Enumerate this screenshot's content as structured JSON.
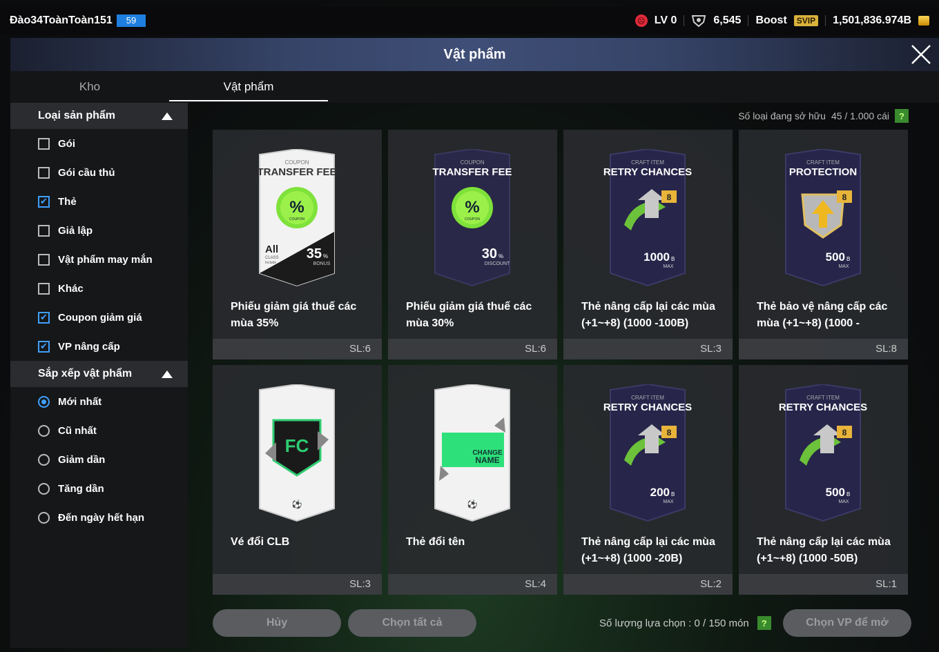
{
  "topbar": {
    "username": "Đào34ToànToàn151",
    "level_badge": "59",
    "lv": "LV 0",
    "points": "6,545",
    "boost": "Boost",
    "svip": "SVIP",
    "balance": "1,501,836.974B"
  },
  "title": "Vật phẩm",
  "tabs": [
    "Kho",
    "Vật phẩm"
  ],
  "sidebar": {
    "filter_header": "Loại sản phẩm",
    "filters": [
      {
        "label": "Gói",
        "checked": false
      },
      {
        "label": "Gói cầu thủ",
        "checked": false
      },
      {
        "label": "Thẻ",
        "checked": true
      },
      {
        "label": "Giả lập",
        "checked": false
      },
      {
        "label": "Vật phẩm may mắn",
        "checked": false
      },
      {
        "label": "Khác",
        "checked": false
      },
      {
        "label": "Coupon giảm giá",
        "checked": true
      },
      {
        "label": "VP nâng cấp",
        "checked": true
      }
    ],
    "sort_header": "Sắp xếp vật phẩm",
    "sorts": [
      {
        "label": "Mới nhất",
        "selected": true
      },
      {
        "label": "Cũ nhất",
        "selected": false
      },
      {
        "label": "Giảm dần",
        "selected": false
      },
      {
        "label": "Tăng dần",
        "selected": false
      },
      {
        "label": "Đến ngày hết hạn",
        "selected": false
      }
    ]
  },
  "owned": {
    "label": "Số loại đang sở hữu",
    "value": "45 / 1.000 cái",
    "help": "?"
  },
  "items": [
    {
      "name": "Phiếu giảm giá thuế các mùa 35%",
      "qty": "SL:6",
      "type": "coupon-white",
      "kind": "COUPON",
      "heading": "TRANSFER FEE",
      "value": "35",
      "unit": "%",
      "sub": "BONUS",
      "extra": "All",
      "extra_sub": "CLASS",
      "extra_sub2": "Include",
      "badge": "COUPON"
    },
    {
      "name": "Phiếu giảm giá thuế các mùa 30%",
      "qty": "SL:6",
      "type": "coupon-dark",
      "kind": "COUPON",
      "heading": "TRANSFER FEE",
      "value": "30",
      "unit": "%",
      "sub": "DISCOUNT",
      "badge": "COUPON"
    },
    {
      "name": "Thẻ nâng cấp lại các mùa (+1~+8) (1000 -100B)",
      "qty": "SL:3",
      "type": "craft",
      "kind": "CRAFT ITEM",
      "heading": "RETRY CHANCES",
      "value": "1000",
      "unit": "B",
      "sub": "MAX",
      "level": "8"
    },
    {
      "name": "Thẻ bảo vệ nâng cấp các mùa (+1~+8) (1000 -",
      "qty": "SL:8",
      "type": "protect",
      "kind": "CRAFT ITEM",
      "heading": "PROTECTION",
      "value": "500",
      "unit": "B",
      "sub": "MAX",
      "level": "8"
    },
    {
      "name": "Vé đổi CLB",
      "qty": "SL:3",
      "type": "club",
      "value": ""
    },
    {
      "name": "Thẻ đổi tên",
      "qty": "SL:4",
      "type": "rename",
      "line1": "CHANGE",
      "line2": "NAME"
    },
    {
      "name": "Thẻ nâng cấp lại các mùa (+1~+8) (1000 -20B)",
      "qty": "SL:2",
      "type": "craft",
      "kind": "CRAFT ITEM",
      "heading": "RETRY CHANCES",
      "value": "200",
      "unit": "B",
      "sub": "MAX",
      "level": "8"
    },
    {
      "name": "Thẻ nâng cấp lại các mùa (+1~+8) (1000 -50B)",
      "qty": "SL:1",
      "type": "craft",
      "kind": "CRAFT ITEM",
      "heading": "RETRY CHANCES",
      "value": "500",
      "unit": "B",
      "sub": "MAX",
      "level": "8"
    }
  ],
  "bottom": {
    "cancel": "Hủy",
    "select_all": "Chọn tất cả",
    "selection_label": "Số lượng lựa chọn : 0 / 150 món",
    "help": "?",
    "open": "Chọn VP để mở"
  }
}
